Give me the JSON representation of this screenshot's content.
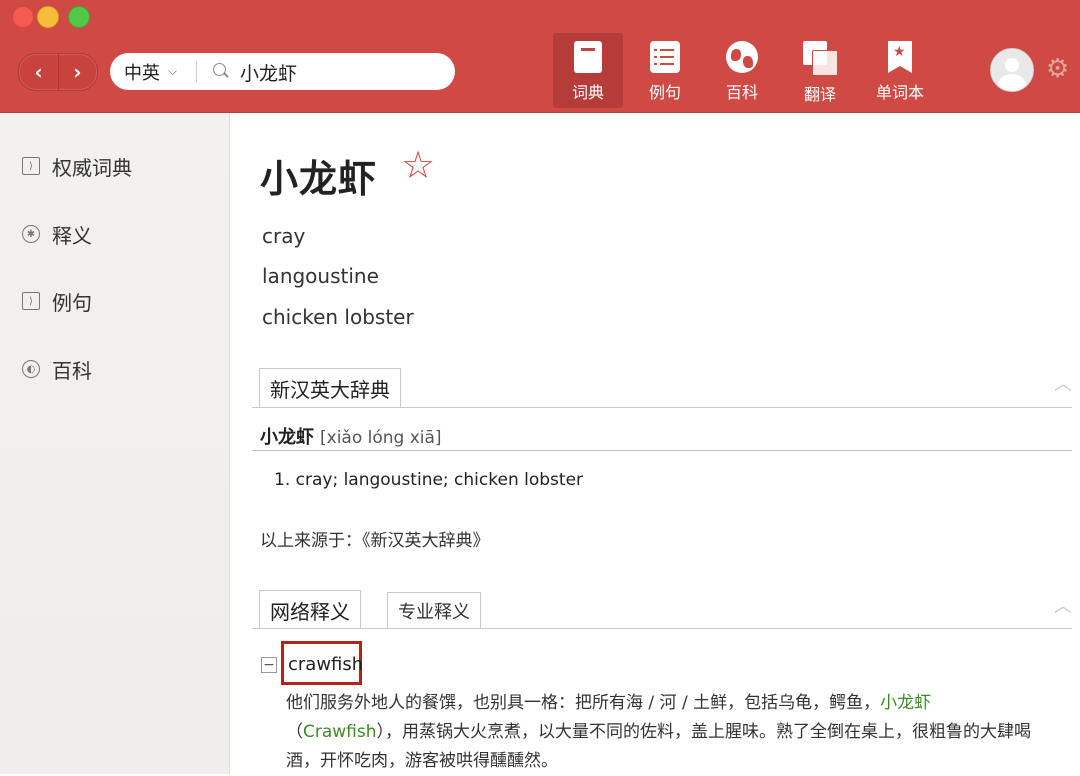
{
  "toolbar": {
    "nav_back": "‹",
    "nav_forward": "›",
    "search": {
      "lang": "中英",
      "query": "小龙虾"
    },
    "tabs": [
      {
        "label": "词典",
        "icon": "book-icon",
        "active": true
      },
      {
        "label": "例句",
        "icon": "list-icon",
        "active": false
      },
      {
        "label": "百科",
        "icon": "globe-icon",
        "active": false
      },
      {
        "label": "翻译",
        "icon": "translate-icon",
        "active": false
      },
      {
        "label": "单词本",
        "icon": "bookmark-star-icon",
        "active": false
      }
    ],
    "accent_color": "#cf4a45"
  },
  "sidebar": {
    "items": [
      {
        "label": "权威词典",
        "icon": "book-icon"
      },
      {
        "label": "释义",
        "icon": "meaning-icon"
      },
      {
        "label": "例句",
        "icon": "list-icon"
      },
      {
        "label": "百科",
        "icon": "globe-icon"
      }
    ]
  },
  "main": {
    "word": "小龙虾",
    "translations": [
      "cray",
      "langoustine",
      "chicken lobster"
    ],
    "dict_section": {
      "tab": "新汉英大辞典",
      "headword": "小龙虾",
      "pinyin": "[xiǎo lóng xiā]",
      "definition": "1.  cray; langoustine; chicken lobster",
      "source": "以上来源于：《新汉英大辞典》"
    },
    "web_section": {
      "tab_active": "网络释义",
      "tab_inactive": "专业释义",
      "term": "crawfish",
      "paragraph_before": "他们服务外地人的餐馔，也别具一格：把所有海 / 河 / 土鲜，包括乌龟，鳄鱼，",
      "highlight1": "小龙虾",
      "paren_open": "（",
      "highlight2": "Crawfish",
      "paragraph_after": "），用蒸锅大火烹煮，以大量不同的佐料，盖上腥味。熟了全倒在桌上，很粗鲁的大肆喝酒，开怀吃肉，游客被哄得醺醺然。"
    }
  }
}
